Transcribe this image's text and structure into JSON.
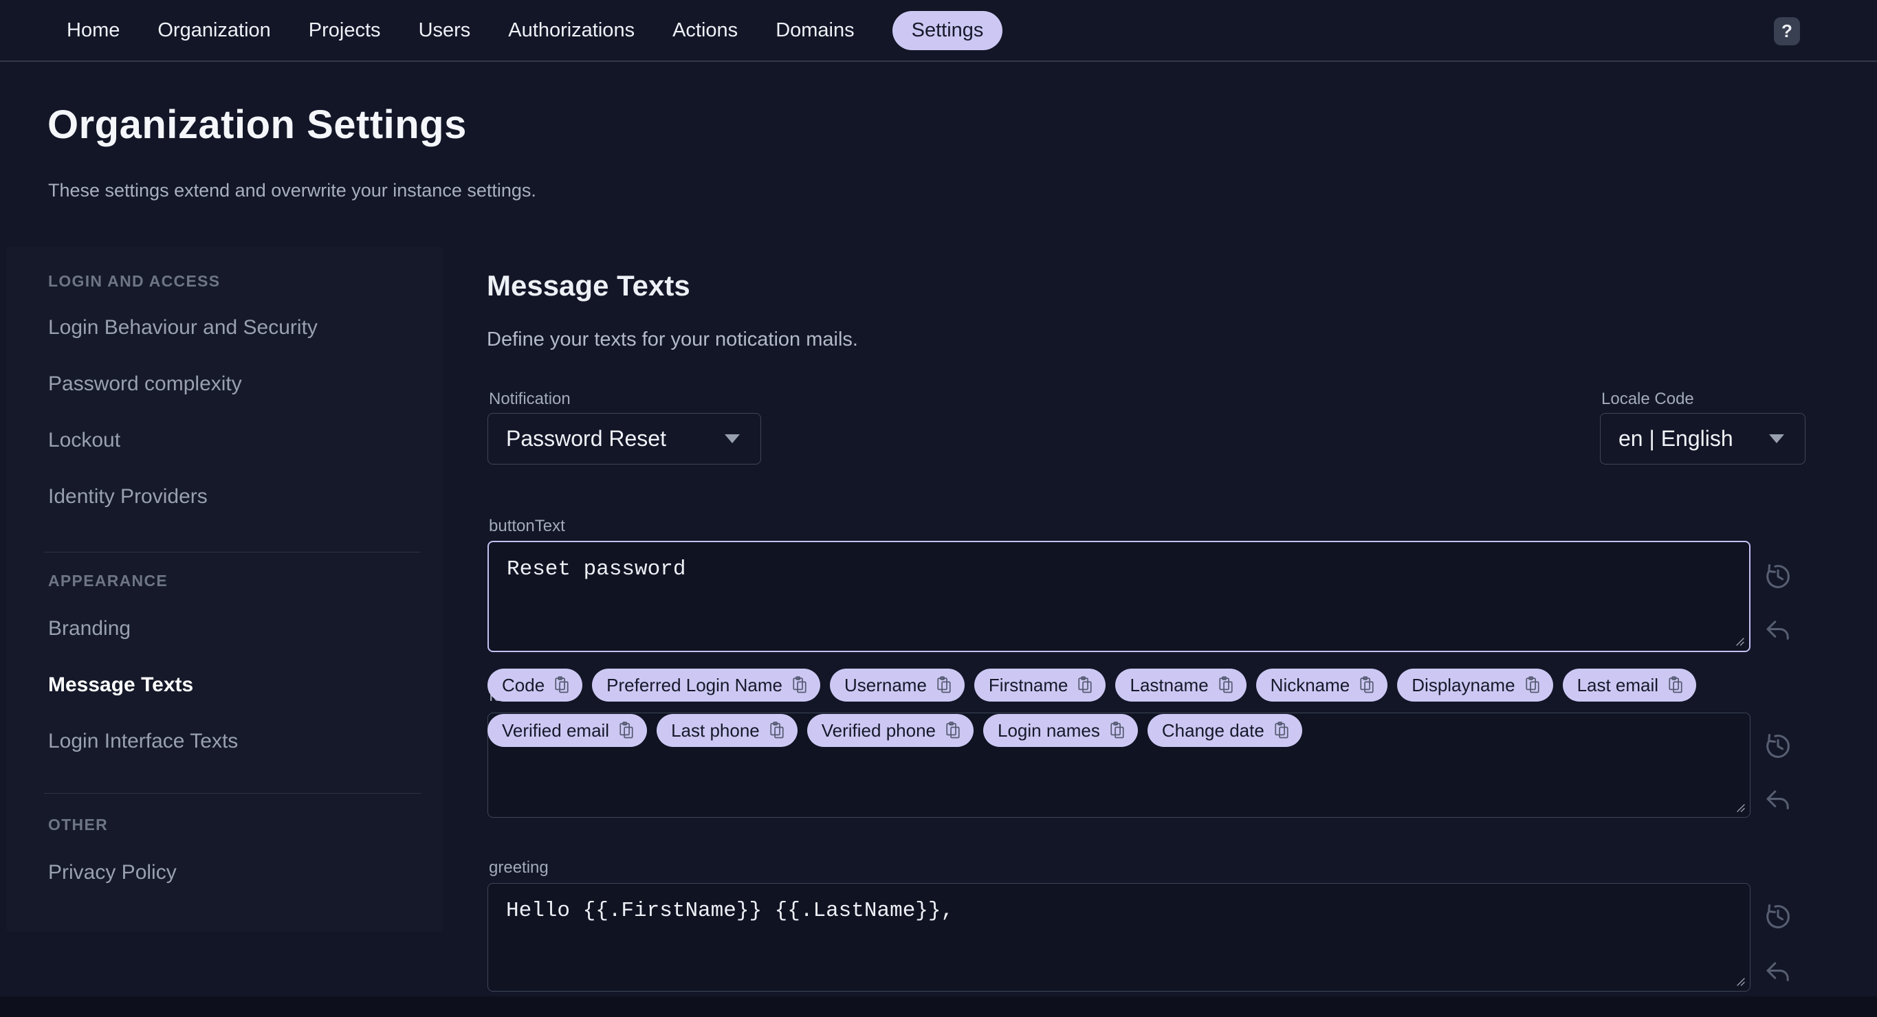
{
  "nav": {
    "items": [
      {
        "label": "Home"
      },
      {
        "label": "Organization"
      },
      {
        "label": "Projects"
      },
      {
        "label": "Users"
      },
      {
        "label": "Authorizations"
      },
      {
        "label": "Actions"
      },
      {
        "label": "Domains"
      },
      {
        "label": "Settings"
      }
    ],
    "active_item": "Settings",
    "help_label": "?"
  },
  "page": {
    "title": "Organization Settings",
    "subtitle": "These settings extend and overwrite your instance settings."
  },
  "sidebar": {
    "sections": [
      {
        "heading": "LOGIN AND ACCESS",
        "items": [
          {
            "label": "Login Behaviour and Security"
          },
          {
            "label": "Password complexity"
          },
          {
            "label": "Lockout"
          },
          {
            "label": "Identity Providers"
          }
        ]
      },
      {
        "heading": "APPEARANCE",
        "items": [
          {
            "label": "Branding"
          },
          {
            "label": "Message Texts",
            "active": true
          },
          {
            "label": "Login Interface Texts"
          }
        ]
      },
      {
        "heading": "OTHER",
        "items": [
          {
            "label": "Privacy Policy"
          }
        ]
      }
    ]
  },
  "main": {
    "heading": "Message Texts",
    "description": "Define your texts for your notication mails.",
    "notification": {
      "label": "Notification",
      "value": "Password Reset"
    },
    "locale": {
      "label": "Locale Code",
      "value": "en | English"
    },
    "fields": {
      "buttonText": {
        "label": "buttonText",
        "value": "Reset password"
      },
      "footerText": {
        "label": "footerText",
        "value": ""
      },
      "greeting": {
        "label": "greeting",
        "value": "Hello {{.FirstName}} {{.LastName}},"
      }
    },
    "chips_row1": [
      {
        "label": "Code"
      },
      {
        "label": "Preferred Login Name"
      },
      {
        "label": "Username"
      },
      {
        "label": "Firstname"
      },
      {
        "label": "Lastname"
      },
      {
        "label": "Nickname"
      },
      {
        "label": "Displayname"
      },
      {
        "label": "Last email"
      }
    ],
    "chips_row2": [
      {
        "label": "Verified email"
      },
      {
        "label": "Last phone"
      },
      {
        "label": "Verified phone"
      },
      {
        "label": "Login names"
      },
      {
        "label": "Change date"
      }
    ]
  },
  "colors": {
    "background": "#121627",
    "sidebar": "#151929",
    "accent": "#cdc8f3",
    "focus_border": "#c6c1f2",
    "input_border": "#3f4658",
    "text_primary": "#f4f6fa",
    "text_muted": "#a3aab9"
  }
}
